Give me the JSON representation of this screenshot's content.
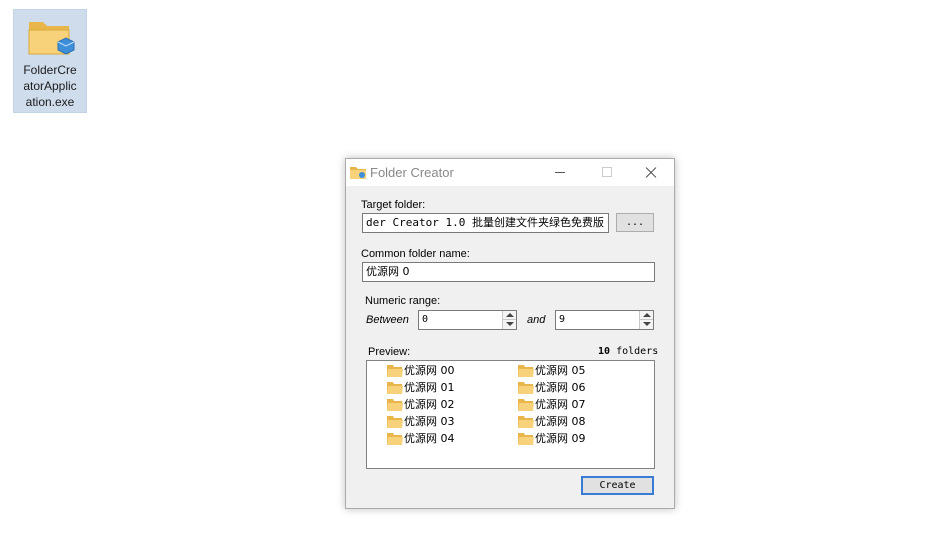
{
  "desktop_icon": {
    "label": "FolderCre\natorApplic\nation.exe"
  },
  "window": {
    "title": "Folder Creator",
    "target_folder": {
      "label": "Target folder:",
      "value": "der Creator 1.0 批量创建文件夹绿色免费版",
      "browse_label": "..."
    },
    "common_name": {
      "label": "Common folder name:",
      "value": "优源网 0"
    },
    "numeric_range": {
      "label": "Numeric range:",
      "between_label": "Between",
      "from_value": "0",
      "and_label": "and",
      "to_value": "9"
    },
    "preview": {
      "label": "Preview:",
      "count_value": "10",
      "count_unit": "folders",
      "items": [
        "优源网 00",
        "优源网 01",
        "优源网 02",
        "优源网 03",
        "优源网 04",
        "优源网 05",
        "优源网 06",
        "优源网 07",
        "优源网 08",
        "优源网 09"
      ]
    },
    "create_label": "Create"
  },
  "colors": {
    "folder": "#f2c55c",
    "accent": "#3a7bd5"
  }
}
